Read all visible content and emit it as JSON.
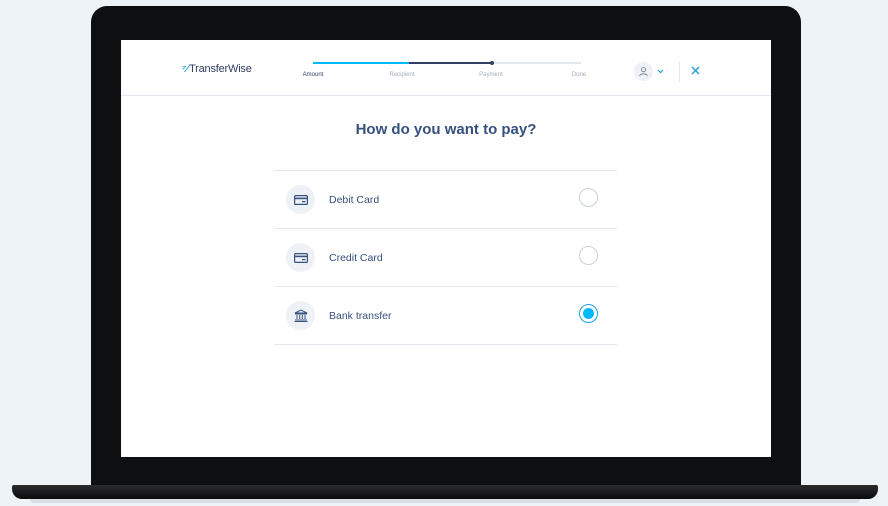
{
  "header": {
    "logo_flag": "⁷⁄",
    "logo_text": "TransferWise"
  },
  "progress": {
    "steps": [
      "Amount",
      "Recipient",
      "Payment",
      "Done"
    ],
    "active_step": 0,
    "completed_fraction": 0.67
  },
  "page_title": "How do you want to pay?",
  "payment_options": [
    {
      "label": "Debit Card",
      "icon": "card-icon",
      "selected": false
    },
    {
      "label": "Credit Card",
      "icon": "card-icon",
      "selected": false
    },
    {
      "label": "Bank transfer",
      "icon": "bank-icon",
      "selected": true
    }
  ],
  "colors": {
    "accent": "#00b9ff",
    "navy": "#37517e"
  }
}
